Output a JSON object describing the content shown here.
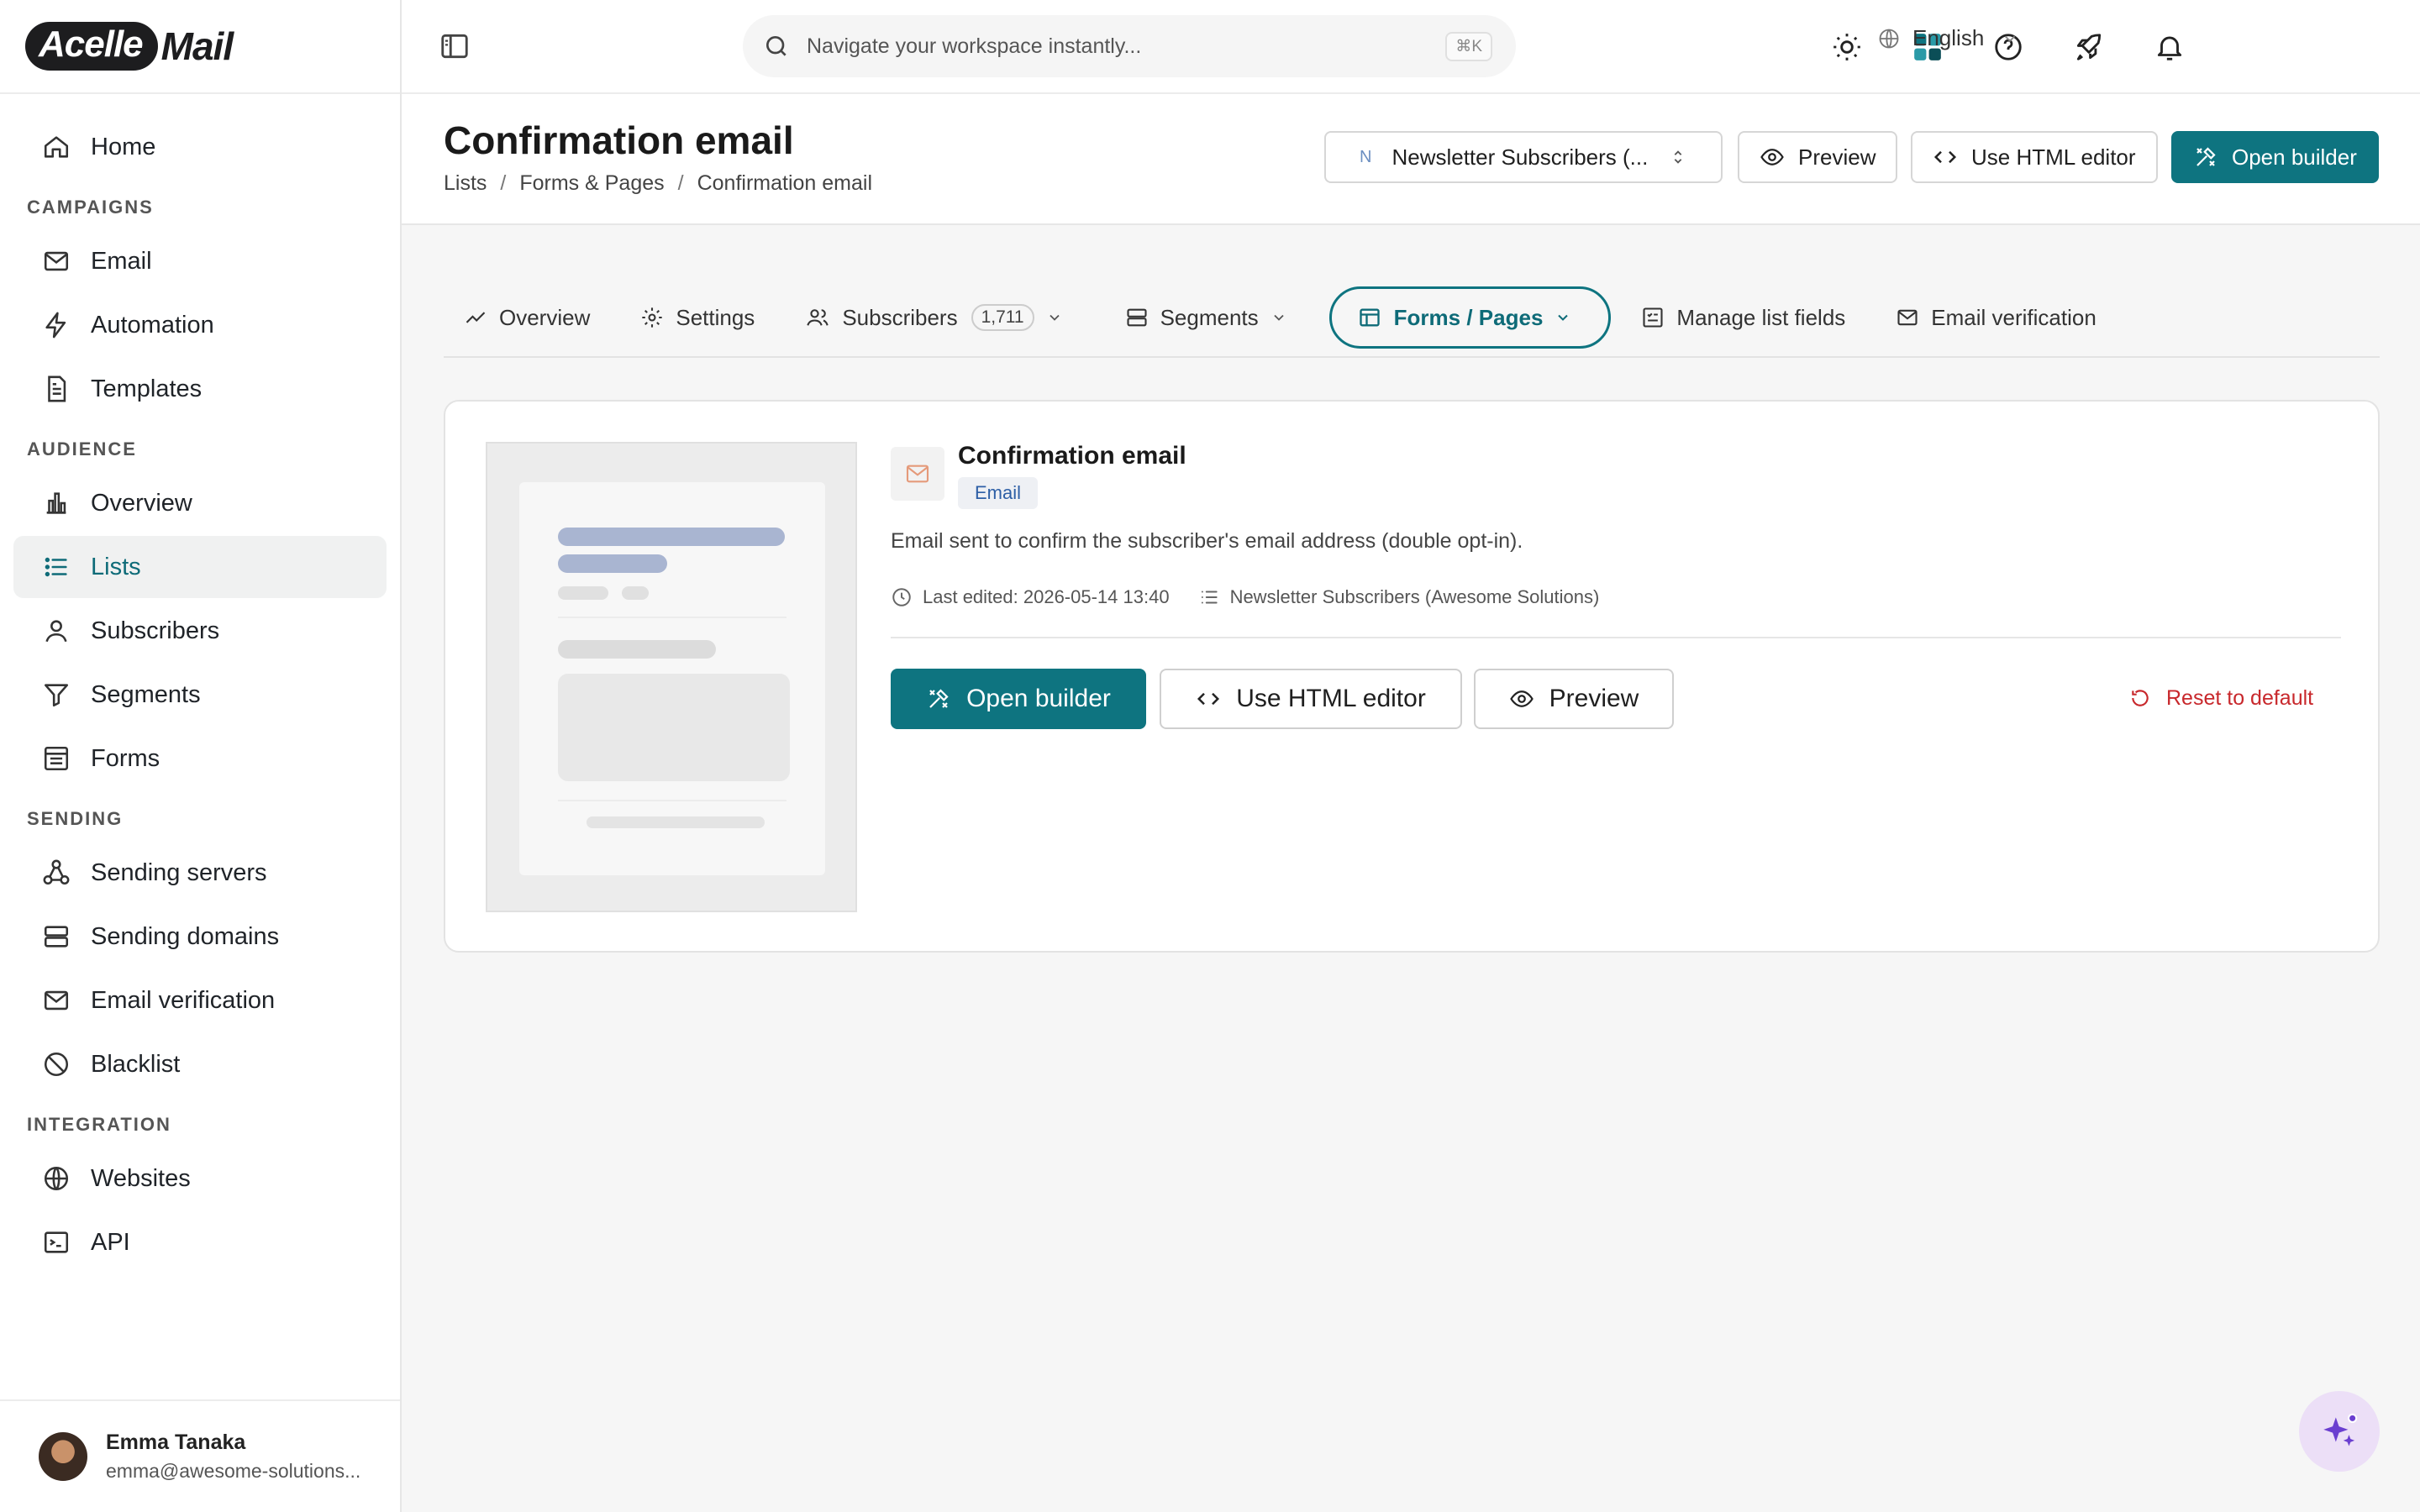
{
  "app": {
    "logo_left": "Acelle",
    "logo_right": "Mail"
  },
  "sidebar": {
    "home": "Home",
    "sections": {
      "campaigns": "CAMPAIGNS",
      "audience": "AUDIENCE",
      "sending": "SENDING",
      "integration": "INTEGRATION"
    },
    "items": {
      "email": "Email",
      "automation": "Automation",
      "templates": "Templates",
      "overview": "Overview",
      "lists": "Lists",
      "subscribers": "Subscribers",
      "segments": "Segments",
      "forms": "Forms",
      "sending_servers": "Sending servers",
      "sending_domains": "Sending domains",
      "email_verification": "Email verification",
      "blacklist": "Blacklist",
      "websites": "Websites",
      "api": "API"
    },
    "active_item": "Lists",
    "user": {
      "name": "Emma Tanaka",
      "email": "emma@awesome-solutions..."
    }
  },
  "topbar": {
    "search_placeholder": "Navigate your workspace instantly...",
    "shortcut": "⌘K",
    "language": "English"
  },
  "header": {
    "title": "Confirmation email",
    "breadcrumb": [
      "Lists",
      "Forms & Pages",
      "Confirmation email"
    ],
    "list_selector": {
      "initial": "N",
      "value": "Newsletter Subscribers (..."
    },
    "preview_label": "Preview",
    "html_editor_label": "Use HTML editor",
    "open_builder_label": "Open builder"
  },
  "tabs": {
    "overview": "Overview",
    "settings": "Settings",
    "subscribers": "Subscribers",
    "subscribers_count": "1,711",
    "segments": "Segments",
    "forms_pages": "Forms / Pages",
    "manage_fields": "Manage list fields",
    "email_verification": "Email verification"
  },
  "card": {
    "title": "Confirmation email",
    "badge": "Email",
    "description": "Email sent to confirm the subscriber's email address (double opt-in).",
    "last_edited": "Last edited: 2026-05-14 13:40",
    "list_name": "Newsletter Subscribers (Awesome Solutions)",
    "open_builder": "Open builder",
    "html_editor": "Use HTML editor",
    "preview": "Preview",
    "reset": "Reset to default"
  },
  "colors": {
    "accent": "#0e7480",
    "danger": "#c8282c",
    "badge_text": "#2d5fa6"
  }
}
